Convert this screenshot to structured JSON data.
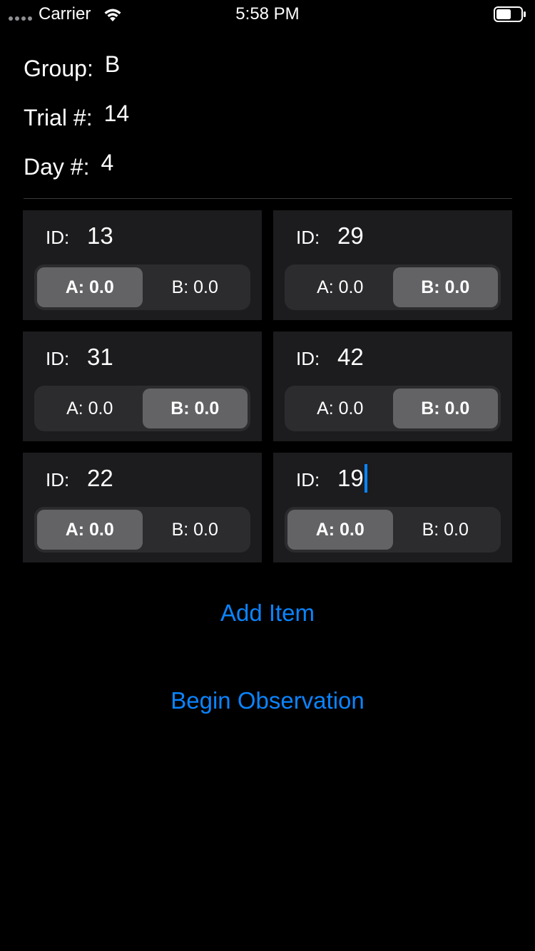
{
  "status_bar": {
    "carrier": "Carrier",
    "time": "5:58 PM",
    "icons": [
      "signal-dots-icon",
      "wifi-icon",
      "battery-icon"
    ]
  },
  "info": {
    "group_label": "Group:",
    "group_value": "B",
    "trial_label": "Trial #:",
    "trial_value": "14",
    "day_label": "Day #:",
    "day_value": "4"
  },
  "items": [
    {
      "id_label": "ID:",
      "id_value": "13",
      "option_a": "A: 0.0",
      "option_b": "B: 0.0",
      "selected": "A"
    },
    {
      "id_label": "ID:",
      "id_value": "29",
      "option_a": "A: 0.0",
      "option_b": "B: 0.0",
      "selected": "B"
    },
    {
      "id_label": "ID:",
      "id_value": "31",
      "option_a": "A: 0.0",
      "option_b": "B: 0.0",
      "selected": "B"
    },
    {
      "id_label": "ID:",
      "id_value": "42",
      "option_a": "A: 0.0",
      "option_b": "B: 0.0",
      "selected": "B"
    },
    {
      "id_label": "ID:",
      "id_value": "22",
      "option_a": "A: 0.0",
      "option_b": "B: 0.0",
      "selected": "A"
    },
    {
      "id_label": "ID:",
      "id_value": "19",
      "option_a": "A: 0.0",
      "option_b": "B: 0.0",
      "selected": "A",
      "editing": true
    }
  ],
  "actions": {
    "add_item": "Add Item",
    "begin_observation": "Begin Observation"
  },
  "colors": {
    "background": "#000000",
    "card": "#1c1c1e",
    "segment_track": "#2c2c2e",
    "segment_selected": "#636366",
    "accent": "#0a84ff",
    "divider": "#3a3a3c"
  }
}
